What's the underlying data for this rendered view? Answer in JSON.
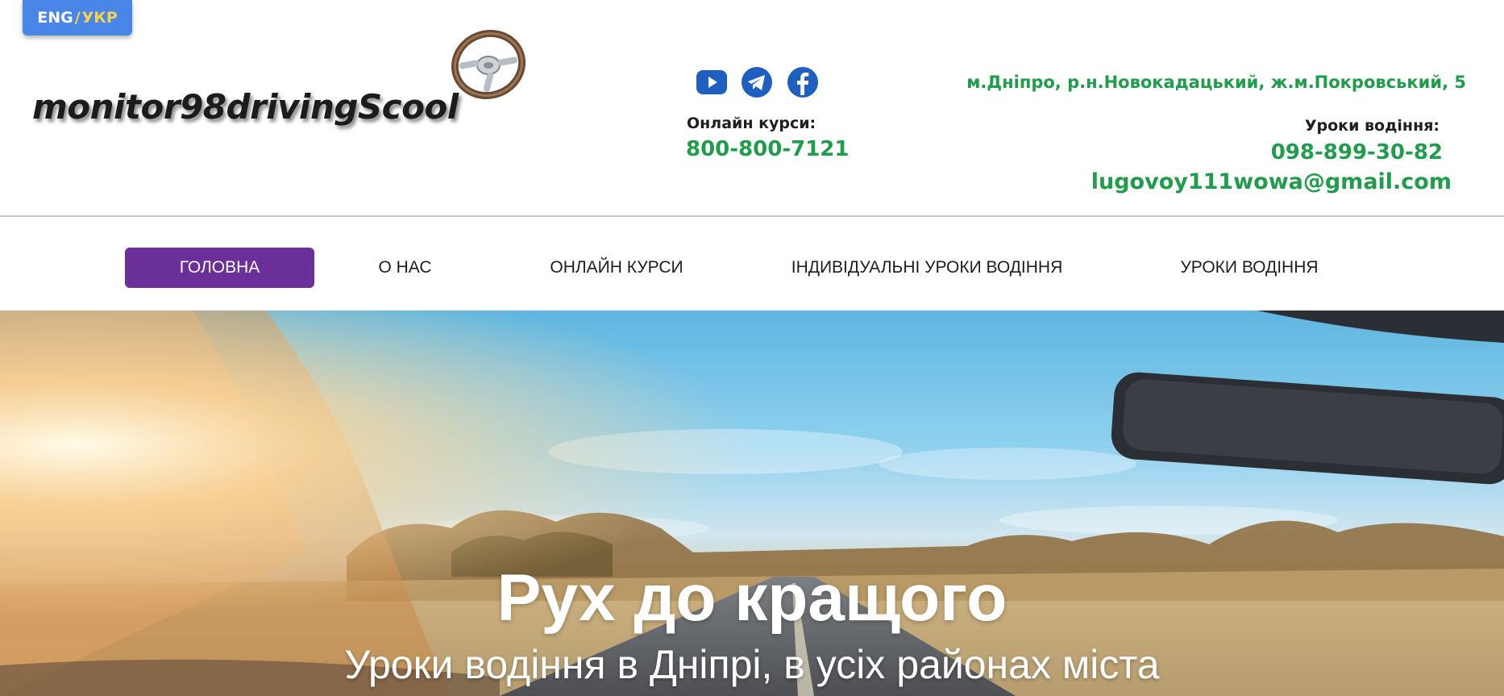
{
  "language_switch": {
    "eng": "ENG",
    "separator": "/",
    "ukr": "УКР"
  },
  "logo": {
    "text": "monitor98drivingScool",
    "icon": "steering-wheel-icon"
  },
  "social": [
    {
      "name": "youtube-icon",
      "color": "#1f5fbf"
    },
    {
      "name": "telegram-icon",
      "color": "#1f5fbf"
    },
    {
      "name": "facebook-icon",
      "color": "#1f5fbf"
    }
  ],
  "online_courses": {
    "label": "Онлайн курси:",
    "phone": "800-800-7121"
  },
  "contacts": {
    "address": "м.Дніпро, р.н.Новокадацький, ж.м.Покровський, 5",
    "lessons_label": "Уроки водіння:",
    "lessons_phone": "098-899-30-82",
    "email": "lugovoy111wowa@gmail.com"
  },
  "nav": {
    "items": [
      {
        "label": "ГОЛОВНА",
        "active": true
      },
      {
        "label": "О НАС",
        "active": false
      },
      {
        "label": "ОНЛАЙН КУРСИ",
        "active": false
      },
      {
        "label": "ІНДИВІДУАЛЬНІ УРОКИ ВОДІННЯ",
        "active": false
      },
      {
        "label": "УРОКИ ВОДІННЯ",
        "active": false
      }
    ]
  },
  "hero": {
    "title": "Рух до кращого",
    "subtitle": "Уроки водіння в Дніпрі, в усіх районах міста"
  },
  "colors": {
    "accent_green": "#1f9d4a",
    "nav_active": "#6b2f99",
    "lang_button": "#4a86e8",
    "lang_highlight": "#f2d34f",
    "social_blue": "#1f5fbf"
  }
}
